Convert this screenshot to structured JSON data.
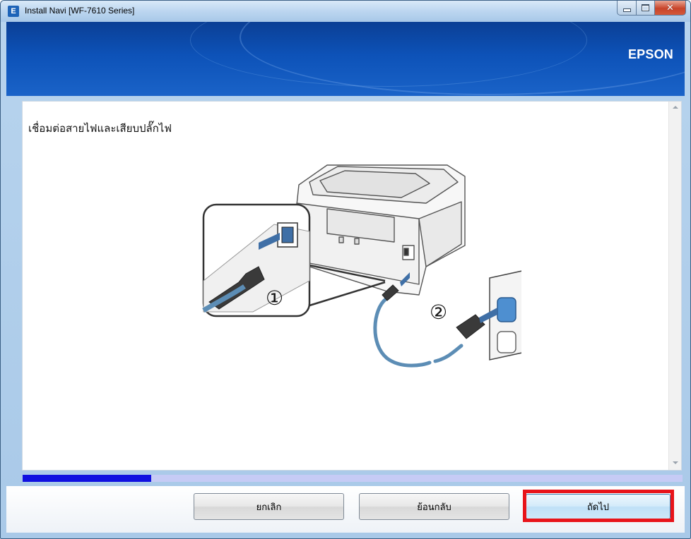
{
  "window": {
    "title": "Install Navi [WF-7610 Series]",
    "app_icon_letter": "E"
  },
  "header": {
    "brand": "EPSON"
  },
  "main": {
    "instruction": "เชื่อมต่อสายไฟและเสียบปลั๊กไฟ",
    "step_markers": [
      "①",
      "②"
    ]
  },
  "progress": {
    "value": 0.195
  },
  "footer": {
    "cancel_label": "ยกเลิก",
    "back_label": "ย้อนกลับ",
    "next_label": "ถัดไป"
  },
  "colors": {
    "header_blue": "#0d52b8",
    "progress_fill": "#1010e0",
    "progress_track": "#c6cbf5",
    "highlight_red": "#e8141a"
  }
}
